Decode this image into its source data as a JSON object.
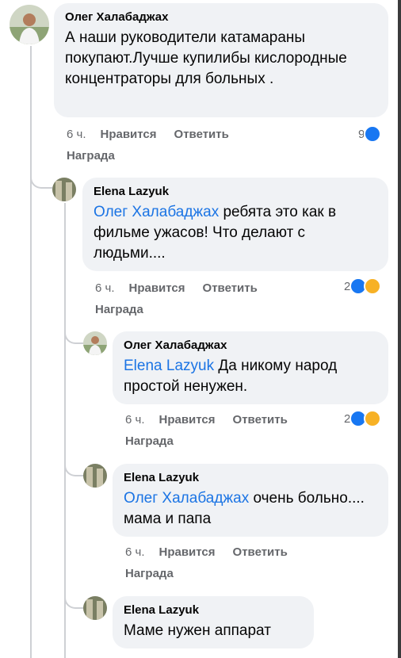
{
  "comments": [
    {
      "author": "Олег Халабаджах",
      "mention": "",
      "text": "А наши руководители катамараны покупают.Лучше  купилибы кислородные концентраторы для больных .",
      "time": "6 ч.",
      "like_label": "Нравится",
      "reply_label": "Ответить",
      "award_label": "Награда",
      "reaction_count": "9",
      "reactions": [
        "like-icon"
      ]
    },
    {
      "author": "Elena Lazyuk",
      "mention": "Олег Халабаджах",
      "text": " ребята это как в фильме ужасов! Что делают с людьми....",
      "time": "6 ч.",
      "like_label": "Нравится",
      "reply_label": "Ответить",
      "award_label": "Награда",
      "reaction_count": "2",
      "reactions": [
        "like-icon",
        "sad-icon"
      ]
    },
    {
      "author": "Олег Халабаджах",
      "mention": "Elena Lazyuk",
      "text": " Да никому народ простой ненужен.",
      "time": "6 ч.",
      "like_label": "Нравится",
      "reply_label": "Ответить",
      "award_label": "Награда",
      "reaction_count": "2",
      "reactions": [
        "like-icon",
        "sad-icon"
      ]
    },
    {
      "author": "Elena Lazyuk",
      "mention": "Олег Халабаджах",
      "text": " очень больно.... мама и папа",
      "time": "6 ч.",
      "like_label": "Нравится",
      "reply_label": "Ответить",
      "award_label": "Награда",
      "reaction_count": "",
      "reactions": []
    },
    {
      "author": "Elena Lazyuk",
      "mention": "",
      "text": "Маме нужен аппарат",
      "time": "",
      "like_label": "",
      "reply_label": "",
      "award_label": "",
      "reaction_count": "",
      "reactions": []
    }
  ],
  "colors": {
    "bubble": "#f0f2f5",
    "mention": "#1b74e4",
    "like": "#1877f2",
    "sad": "#f7b125",
    "meta": "#65676b"
  }
}
